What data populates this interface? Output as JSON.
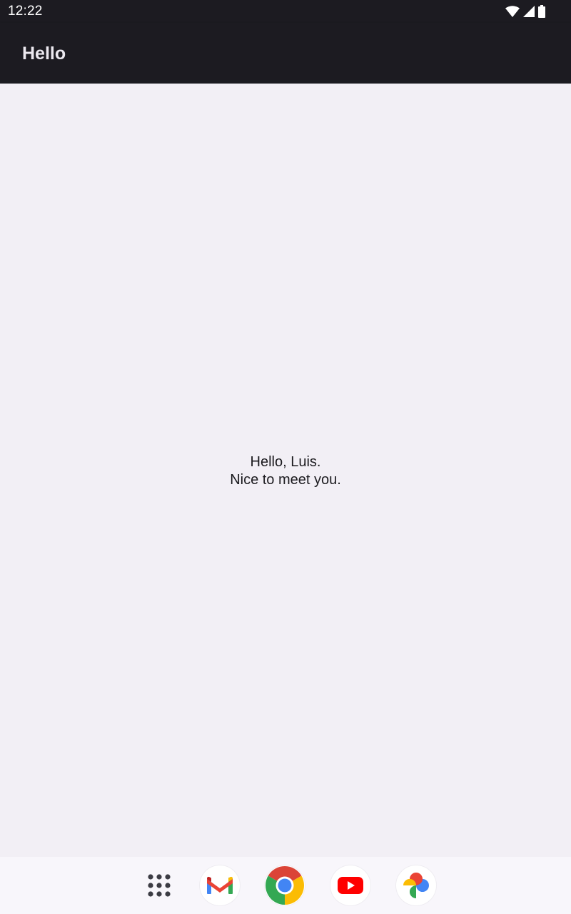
{
  "status_bar": {
    "time": "12:22",
    "icons": [
      "wifi-icon",
      "cell-signal-icon",
      "battery-icon"
    ]
  },
  "app_bar": {
    "title": "Hello"
  },
  "main": {
    "greeting_line1": "Hello, Luis.",
    "greeting_line2": "Nice to meet you."
  },
  "dock": {
    "items": [
      {
        "name": "app-drawer",
        "icon": "grid-dots-icon"
      },
      {
        "name": "gmail",
        "icon": "gmail-icon"
      },
      {
        "name": "chrome",
        "icon": "chrome-icon"
      },
      {
        "name": "youtube",
        "icon": "youtube-icon"
      },
      {
        "name": "photos",
        "icon": "photos-icon"
      }
    ]
  },
  "colors": {
    "bar_background": "#1c1b21",
    "content_background": "#f2eff5",
    "dock_background": "#f8f6fb",
    "title_text": "#ece9f0",
    "body_text": "#1c1b1f"
  }
}
